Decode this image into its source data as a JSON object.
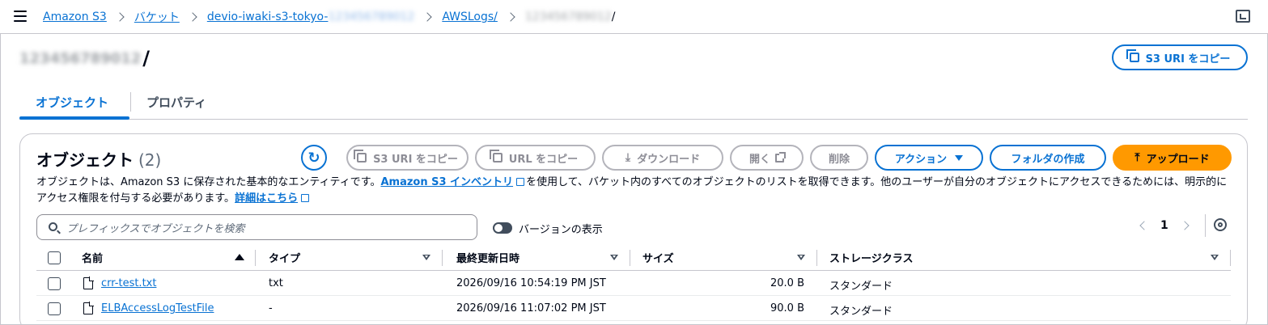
{
  "breadcrumb": {
    "items": [
      "Amazon S3",
      "バケット",
      "devio-iwaki-s3-tokyo-",
      "AWSLogs/"
    ],
    "bucket_suffix_redacted": "123456789012",
    "account_redacted": "123456789012",
    "trailing": "/"
  },
  "header": {
    "title_redacted": "123456789012",
    "title_suffix": "/",
    "copy_uri_label": "S3 URI をコピー"
  },
  "tabs": [
    {
      "label": "オブジェクト",
      "active": true
    },
    {
      "label": "プロパティ",
      "active": false
    }
  ],
  "objects_panel": {
    "title": "オブジェクト",
    "count": "(2)",
    "buttons": {
      "copy_s3_uri": "S3 URI をコピー",
      "copy_url": "URL をコピー",
      "download": "ダウンロード",
      "open": "開く",
      "delete": "削除",
      "actions": "アクション",
      "create_folder": "フォルダの作成",
      "upload": "アップロード"
    },
    "description": {
      "part1": "オブジェクトは、Amazon S3 に保存された基本的なエンティティです。",
      "link1": "Amazon S3 インベントリ",
      "part2": "を使用して、バケット内のすべてのオブジェクトのリストを取得できます。他のユーザーが自分のオブジェクトにアクセスできるためには、明示的にアクセス権限を付与する必要があります。",
      "link2": "詳細はこちら"
    },
    "search_placeholder": "プレフィックスでオブジェクトを検索",
    "versions_toggle_label": "バージョンの表示",
    "page_number": "1",
    "columns": [
      "名前",
      "タイプ",
      "最終更新日時",
      "サイズ",
      "ストレージクラス"
    ],
    "rows": [
      {
        "name": "crr-test.txt",
        "type": "txt",
        "modified": "2026/09/16 10:54:19 PM JST",
        "size": "20.0 B",
        "storage": "スタンダード"
      },
      {
        "name": "ELBAccessLogTestFile",
        "type": "-",
        "modified": "2026/09/16 11:07:02 PM JST",
        "size": "90.0 B",
        "storage": "スタンダード"
      }
    ]
  },
  "colors": {
    "link": "#0972d3",
    "upload_button": "#ff9900",
    "disabled_border": "#b4b4bb",
    "text": "#000716"
  }
}
